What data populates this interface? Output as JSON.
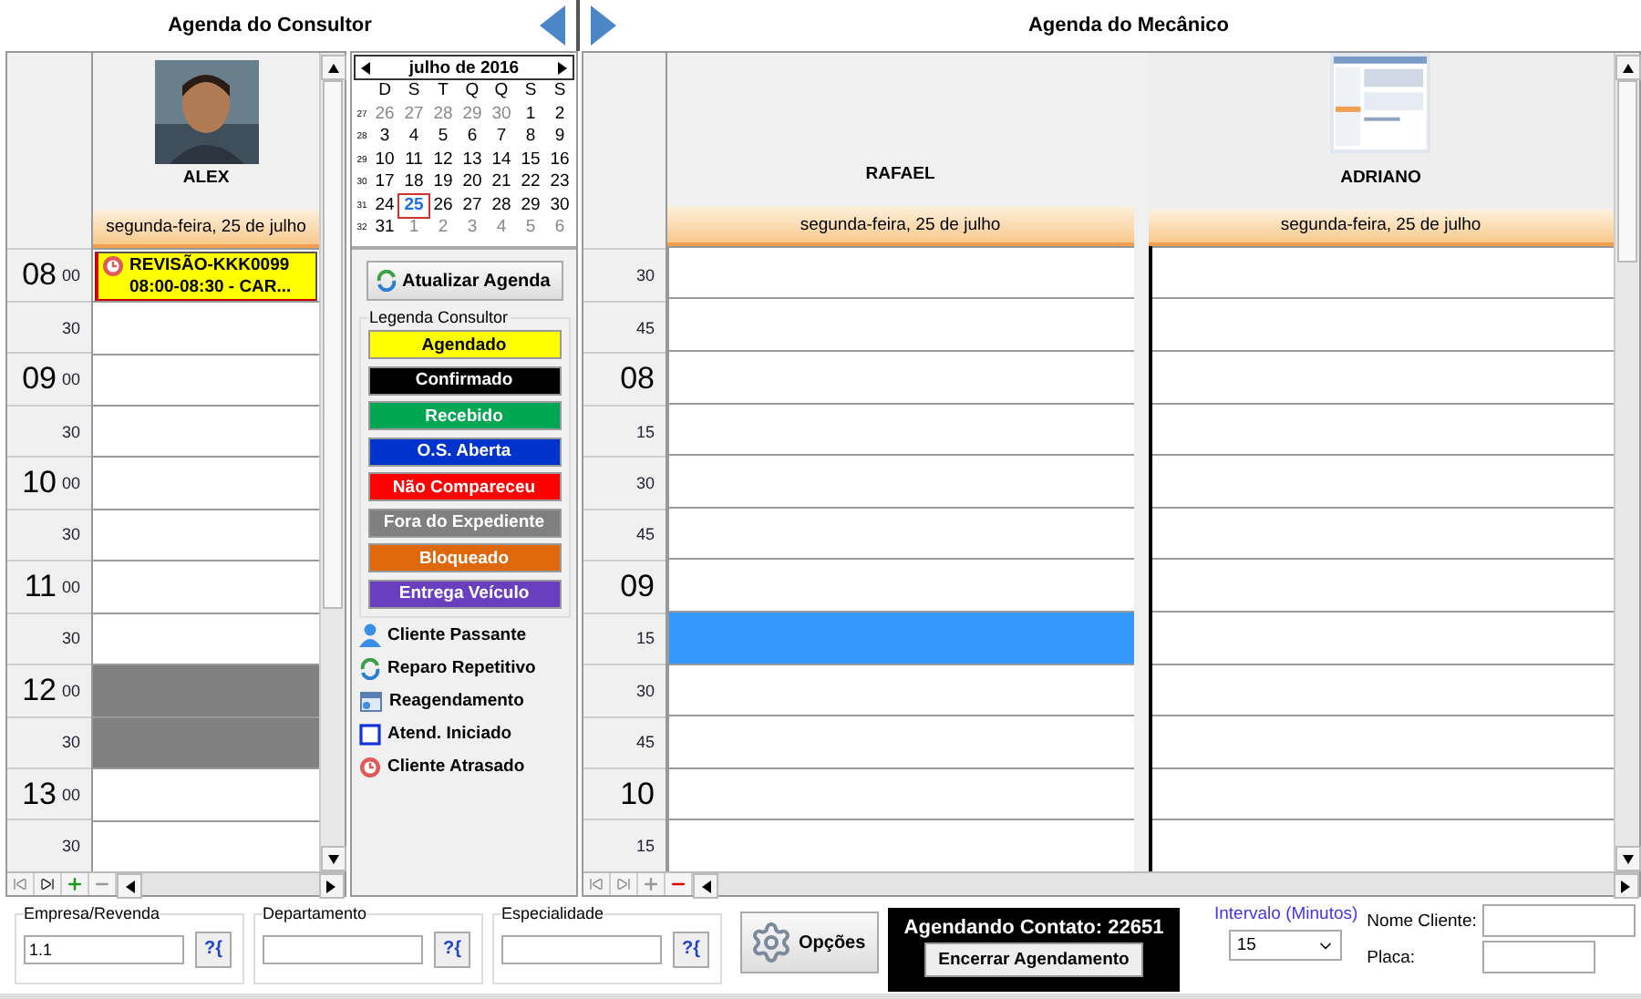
{
  "consultor": {
    "title": "Agenda do Consultor",
    "name": "ALEX",
    "date": "segunda-feira, 25 de julho",
    "slots": [
      {
        "hour": "08",
        "minute": "00",
        "kind": "free",
        "appointment": {
          "title": "REVISÃO-KKK0099",
          "detail": "08:00-08:30 - CAR...",
          "late": true
        }
      },
      {
        "minute": "30",
        "kind": "free"
      },
      {
        "hour": "09",
        "minute": "00",
        "kind": "free"
      },
      {
        "minute": "30",
        "kind": "free"
      },
      {
        "hour": "10",
        "minute": "00",
        "kind": "free"
      },
      {
        "minute": "30",
        "kind": "free"
      },
      {
        "hour": "11",
        "minute": "00",
        "kind": "free"
      },
      {
        "minute": "30",
        "kind": "free"
      },
      {
        "hour": "12",
        "minute": "00",
        "kind": "blocked"
      },
      {
        "minute": "30",
        "kind": "blocked"
      },
      {
        "hour": "13",
        "minute": "00",
        "kind": "free"
      },
      {
        "minute": "30",
        "kind": "free"
      }
    ]
  },
  "calendar": {
    "month": "julho de 2016",
    "weekdays": [
      "D",
      "S",
      "T",
      "Q",
      "Q",
      "S",
      "S"
    ],
    "weeks": [
      {
        "week": "27",
        "days": [
          {
            "day": "26",
            "other": true,
            "selected": false
          },
          {
            "day": "27",
            "other": true,
            "selected": false
          },
          {
            "day": "28",
            "other": true,
            "selected": false
          },
          {
            "day": "29",
            "other": true,
            "selected": false
          },
          {
            "day": "30",
            "other": true,
            "selected": false
          },
          {
            "day": "1",
            "other": false,
            "selected": false
          },
          {
            "day": "2",
            "other": false,
            "selected": false
          }
        ]
      },
      {
        "week": "28",
        "days": [
          {
            "day": "3",
            "other": false,
            "selected": false
          },
          {
            "day": "4",
            "other": false,
            "selected": false
          },
          {
            "day": "5",
            "other": false,
            "selected": false
          },
          {
            "day": "6",
            "other": false,
            "selected": false
          },
          {
            "day": "7",
            "other": false,
            "selected": false
          },
          {
            "day": "8",
            "other": false,
            "selected": false
          },
          {
            "day": "9",
            "other": false,
            "selected": false
          }
        ]
      },
      {
        "week": "29",
        "days": [
          {
            "day": "10",
            "other": false,
            "selected": false
          },
          {
            "day": "11",
            "other": false,
            "selected": false
          },
          {
            "day": "12",
            "other": false,
            "selected": false
          },
          {
            "day": "13",
            "other": false,
            "selected": false
          },
          {
            "day": "14",
            "other": false,
            "selected": false
          },
          {
            "day": "15",
            "other": false,
            "selected": false
          },
          {
            "day": "16",
            "other": false,
            "selected": false
          }
        ]
      },
      {
        "week": "30",
        "days": [
          {
            "day": "17",
            "other": false,
            "selected": false
          },
          {
            "day": "18",
            "other": false,
            "selected": false
          },
          {
            "day": "19",
            "other": false,
            "selected": false
          },
          {
            "day": "20",
            "other": false,
            "selected": false
          },
          {
            "day": "21",
            "other": false,
            "selected": false
          },
          {
            "day": "22",
            "other": false,
            "selected": false
          },
          {
            "day": "23",
            "other": false,
            "selected": false
          }
        ]
      },
      {
        "week": "31",
        "days": [
          {
            "day": "24",
            "other": false,
            "selected": false
          },
          {
            "day": "25",
            "other": false,
            "selected": true
          },
          {
            "day": "26",
            "other": false,
            "selected": false
          },
          {
            "day": "27",
            "other": false,
            "selected": false
          },
          {
            "day": "28",
            "other": false,
            "selected": false
          },
          {
            "day": "29",
            "other": false,
            "selected": false
          },
          {
            "day": "30",
            "other": false,
            "selected": false
          }
        ]
      },
      {
        "week": "32",
        "days": [
          {
            "day": "31",
            "other": false,
            "selected": false
          },
          {
            "day": "1",
            "other": true,
            "selected": false
          },
          {
            "day": "2",
            "other": true,
            "selected": false
          },
          {
            "day": "3",
            "other": true,
            "selected": false
          },
          {
            "day": "4",
            "other": true,
            "selected": false
          },
          {
            "day": "5",
            "other": true,
            "selected": false
          },
          {
            "day": "6",
            "other": true,
            "selected": false
          }
        ]
      }
    ]
  },
  "legend": {
    "refresh": "Atualizar Agenda",
    "title": "Legenda Consultor",
    "statuses": [
      {
        "label": "Agendado",
        "color": "#ffff00"
      },
      {
        "label": "Confirmado",
        "color": "#000000"
      },
      {
        "label": "Recebido",
        "color": "#00a651"
      },
      {
        "label": "O.S. Aberta",
        "color": "#0033cc"
      },
      {
        "label": "Não Compareceu",
        "color": "#ff0000"
      },
      {
        "label": "Fora do Expediente",
        "color": "#808080"
      },
      {
        "label": "Bloqueado",
        "color": "#e0680c"
      },
      {
        "label": "Entrega Veículo",
        "color": "#6a3fbf"
      }
    ],
    "icons": [
      {
        "label": "Cliente Passante",
        "kind": "person"
      },
      {
        "label": "Reparo Repetitivo",
        "kind": "repeat"
      },
      {
        "label": "Reagendamento",
        "kind": "calendar"
      },
      {
        "label": "Atend. Iniciado",
        "kind": "square"
      },
      {
        "label": "Cliente Atrasado",
        "kind": "late"
      }
    ]
  },
  "mecanico": {
    "title": "Agenda do Mecânico",
    "slots": [
      {
        "minute": "30"
      },
      {
        "minute": "45"
      },
      {
        "hour": "08"
      },
      {
        "minute": "15"
      },
      {
        "minute": "30"
      },
      {
        "minute": "45"
      },
      {
        "hour": "09"
      },
      {
        "minute": "15"
      },
      {
        "minute": "30"
      },
      {
        "minute": "45"
      },
      {
        "hour": "10"
      },
      {
        "minute": "15"
      }
    ],
    "mechanics": [
      {
        "name": "RAFAEL",
        "date": "segunda-feira, 25 de julho",
        "photo": false,
        "cells": [
          {
            "selected": false
          },
          {
            "selected": false
          },
          {
            "selected": false
          },
          {
            "selected": false
          },
          {
            "selected": false
          },
          {
            "selected": false
          },
          {
            "selected": false
          },
          {
            "selected": true
          },
          {
            "selected": false
          },
          {
            "selected": false
          },
          {
            "selected": false
          },
          {
            "selected": false
          }
        ]
      },
      {
        "name": "ADRIANO",
        "date": "segunda-feira, 25 de julho",
        "photo": true,
        "cells": [
          {
            "selected": false
          },
          {
            "selected": false
          },
          {
            "selected": false
          },
          {
            "selected": false
          },
          {
            "selected": false
          },
          {
            "selected": false
          },
          {
            "selected": false
          },
          {
            "selected": false
          },
          {
            "selected": false
          },
          {
            "selected": false
          },
          {
            "selected": false
          },
          {
            "selected": false
          }
        ]
      }
    ]
  },
  "filters": [
    {
      "label": "Empresa/Revenda",
      "value": "1.1",
      "lookup": "?{"
    },
    {
      "label": "Departamento",
      "lookup": "?{"
    },
    {
      "label": "Especialidade",
      "lookup": "?{"
    }
  ],
  "options": "Opções",
  "contact": {
    "title": "Agendando Contato: 22651",
    "button": "Encerrar Agendamento"
  },
  "interval": {
    "label": "Intervalo (Minutos)",
    "value": "15"
  },
  "client": {
    "name_label": "Nome Cliente:",
    "plate_label": "Placa:"
  }
}
